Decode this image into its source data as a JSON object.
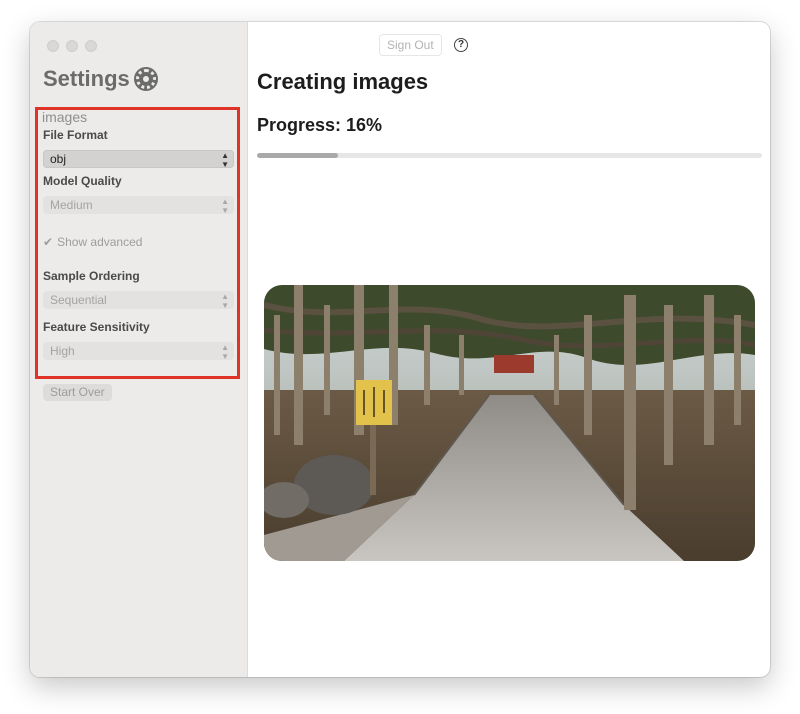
{
  "sidebar": {
    "title": "Settings",
    "title_icon": "gear-icon",
    "section_title": "images",
    "file_format": {
      "label": "File Format",
      "value": "obj"
    },
    "model_quality": {
      "label": "Model Quality",
      "value": "Medium"
    },
    "show_advanced": {
      "label": "Show advanced",
      "checked": true
    },
    "sample_ordering": {
      "label": "Sample Ordering",
      "value": "Sequential"
    },
    "feature_sensitivity": {
      "label": "Feature Sensitivity",
      "value": "High"
    },
    "start_over_label": "Start Over",
    "highlight_color": "#e03327"
  },
  "toolbar": {
    "sign_out_label": "Sign Out",
    "help_icon": "question-circle-icon",
    "help_glyph": "?"
  },
  "main": {
    "title": "Creating images",
    "progress_label": "Progress: 16%",
    "progress_fraction": 0.16
  }
}
